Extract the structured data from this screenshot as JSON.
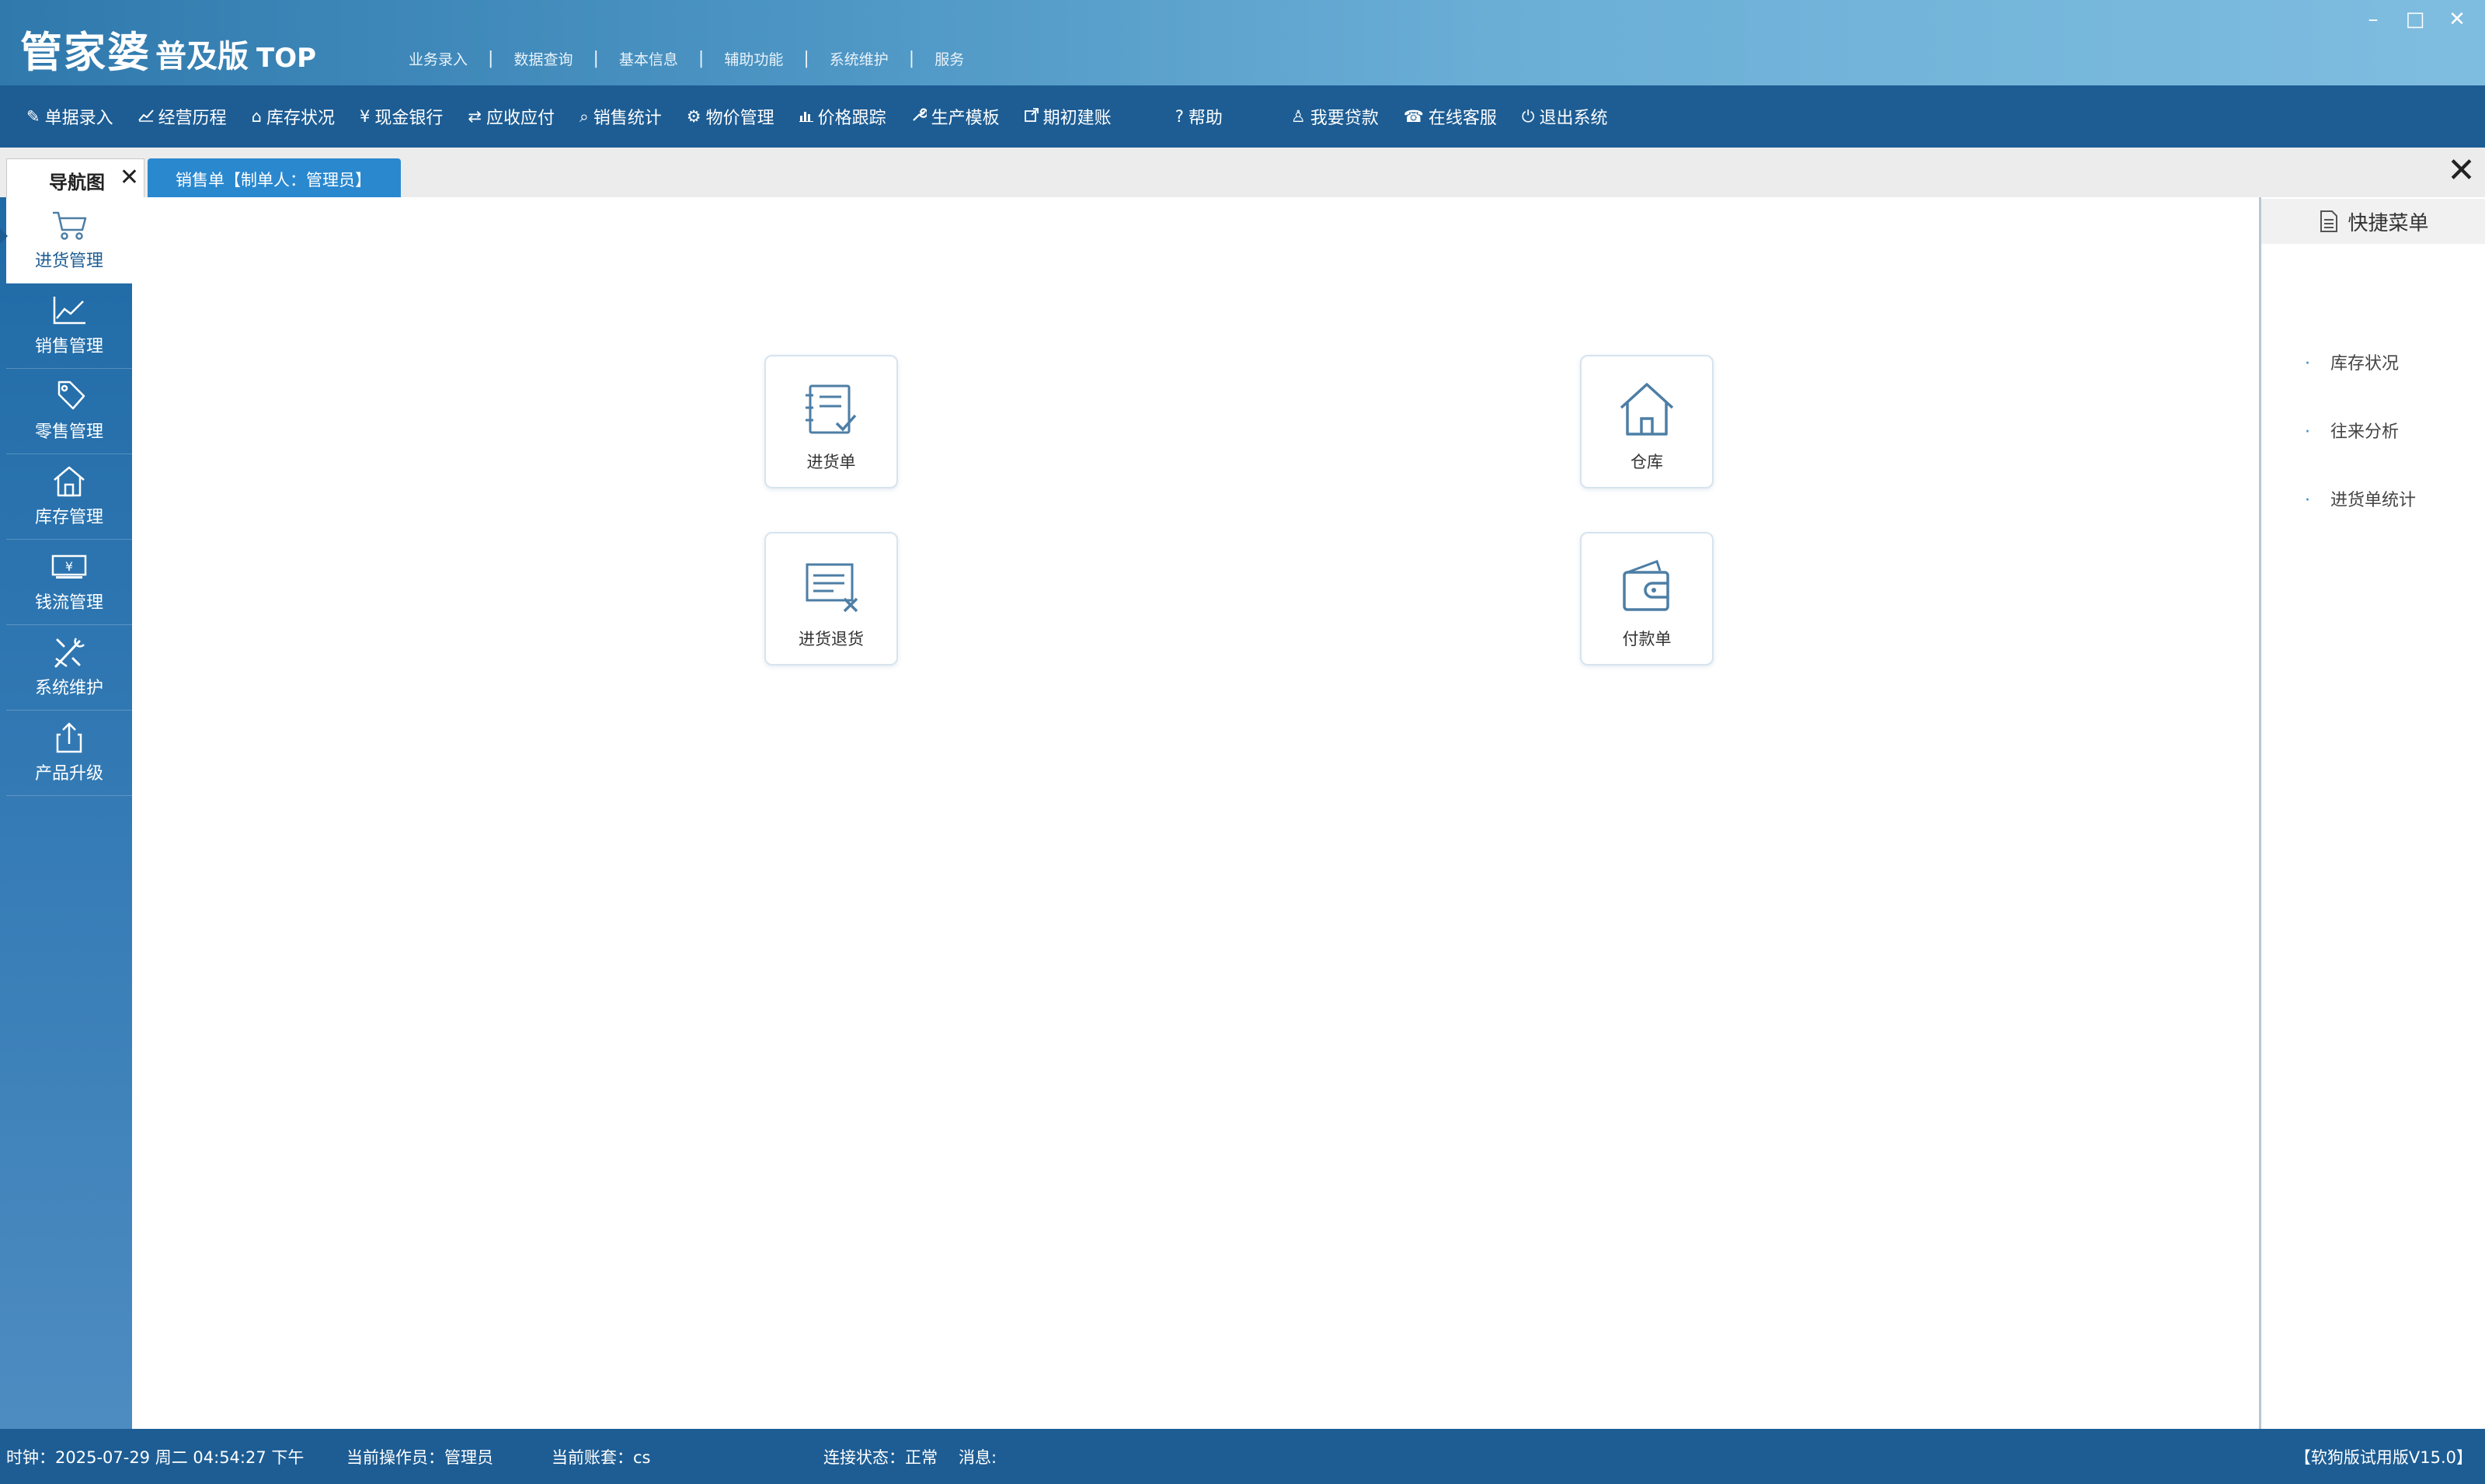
{
  "app": {
    "logo_main": "管家婆",
    "logo_edition": "普及版",
    "logo_top": "TOP"
  },
  "top_menu": [
    "业务录入",
    "数据查询",
    "基本信息",
    "辅助功能",
    "系统维护",
    "服务"
  ],
  "window_controls": {
    "minimize": "–",
    "maximize": "□",
    "close": "✕"
  },
  "toolbar": [
    {
      "icon": "document-edit-icon",
      "glyph": "✎",
      "label": "单据录入"
    },
    {
      "icon": "trend-chart-icon",
      "glyph": "📈",
      "label": "经营历程"
    },
    {
      "icon": "house-icon",
      "glyph": "⌂",
      "label": "库存状况"
    },
    {
      "icon": "yen-icon",
      "glyph": "¥",
      "label": "现金银行"
    },
    {
      "icon": "exchange-icon",
      "glyph": "⇄",
      "label": "应收应付"
    },
    {
      "icon": "search-icon",
      "glyph": "⌕",
      "label": "销售统计"
    },
    {
      "icon": "gear-icon",
      "glyph": "⚙",
      "label": "物价管理"
    },
    {
      "icon": "bar-chart-icon",
      "glyph": "▥",
      "label": "价格跟踪"
    },
    {
      "icon": "wrench-icon",
      "glyph": "🔧",
      "label": "生产模板"
    },
    {
      "icon": "external-link-icon",
      "glyph": "⇱",
      "label": "期初建账"
    },
    {
      "icon": "question-icon",
      "glyph": "?",
      "label": "帮助"
    },
    {
      "icon": "money-bag-icon",
      "glyph": "♙",
      "label": "我要贷款"
    },
    {
      "icon": "headset-icon",
      "glyph": "☎",
      "label": "在线客服"
    },
    {
      "icon": "power-icon",
      "glyph": "⏻",
      "label": "退出系统"
    }
  ],
  "tabs": {
    "nav_label": "导航图",
    "nav_close": "✕",
    "sales_label": "销售单【制单人：管理员】",
    "close_all": "✕"
  },
  "sidebar": [
    {
      "label": "进货管理",
      "icon": "shopping-cart-icon",
      "active": true
    },
    {
      "label": "销售管理",
      "icon": "line-chart-icon",
      "active": false
    },
    {
      "label": "零售管理",
      "icon": "price-tag-icon",
      "active": false
    },
    {
      "label": "库存管理",
      "icon": "warehouse-icon",
      "active": false
    },
    {
      "label": "钱流管理",
      "icon": "cash-icon",
      "active": false
    },
    {
      "label": "系统维护",
      "icon": "tools-icon",
      "active": false
    },
    {
      "label": "产品升级",
      "icon": "upload-icon",
      "active": false
    }
  ],
  "tiles": [
    {
      "label": "进货单",
      "icon": "purchase-order-icon"
    },
    {
      "label": "仓库",
      "icon": "warehouse-icon"
    },
    {
      "label": "进货退货",
      "icon": "purchase-return-icon"
    },
    {
      "label": "付款单",
      "icon": "wallet-icon"
    }
  ],
  "quick_menu": {
    "title": "快捷菜单",
    "items": [
      "库存状况",
      "往来分析",
      "进货单统计"
    ]
  },
  "status": {
    "clock": "时钟：2025-07-29 周二 04:54:27 下午",
    "operator": "当前操作员：管理员",
    "account": "当前账套：cs",
    "connection": "连接状态：正常",
    "message": "消息:",
    "version": "【软狗版试用版V15.0】"
  },
  "colors": {
    "toolbar_bg": "#1d5d94",
    "tab_active": "#2a88cf",
    "icon_blue": "#4d7ea5"
  }
}
